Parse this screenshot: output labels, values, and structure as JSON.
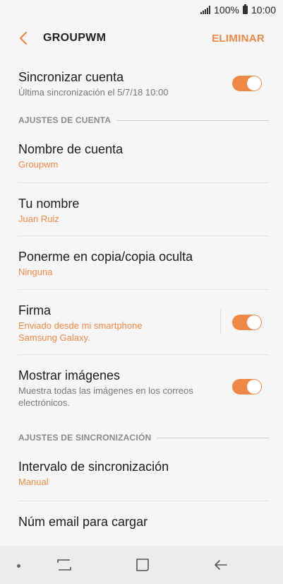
{
  "status": {
    "battery_pct": "100%",
    "time": "10:00"
  },
  "appbar": {
    "title": "GROUPWM",
    "delete_label": "ELIMINAR"
  },
  "items": {
    "sync_account": {
      "title": "Sincronizar cuenta",
      "subtitle": "Última sincronización el 5/7/18  10:00",
      "enabled": true
    },
    "account_name": {
      "title": "Nombre de cuenta",
      "value": "Groupwm"
    },
    "your_name": {
      "title": "Tu nombre",
      "value": "Juan Ruiz"
    },
    "cc_bcc": {
      "title": "Ponerme en copia/copia oculta",
      "value": "Ninguna"
    },
    "signature": {
      "title": "Firma",
      "value_line1": "Enviado desde mi smartphone",
      "value_line2": "Samsung Galaxy.",
      "enabled": true
    },
    "show_images": {
      "title": "Mostrar imágenes",
      "desc_line1": "Muestra todas las imágenes en los correos",
      "desc_line2": "electrónicos.",
      "enabled": true
    },
    "sync_interval": {
      "title": "Intervalo de sincronización",
      "value": "Manual"
    },
    "email_count": {
      "title": "Núm email para cargar"
    }
  },
  "sections": {
    "account_settings": "AJUSTES DE CUENTA",
    "sync_settings": "AJUSTES DE SINCRONIZACIÓN"
  },
  "colors": {
    "accent": "#f08845",
    "background": "#f6f6f6"
  },
  "icons": {
    "back": "chevron-left-icon",
    "recent": "recent-apps-icon",
    "home": "home-icon",
    "nav_back": "nav-back-icon"
  }
}
